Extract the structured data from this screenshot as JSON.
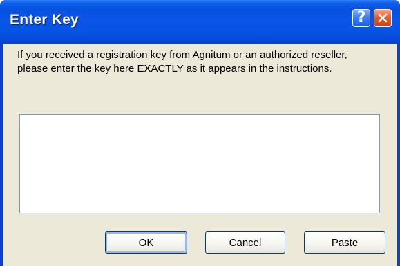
{
  "window": {
    "title": "Enter Key",
    "help_glyph": "?",
    "close_icon": "close-x-icon",
    "help_icon": "help-question-icon"
  },
  "dialog": {
    "message": "If you received a registration key from Agnitum or an authorized reseller, please enter the key here EXACTLY as it appears in the instructions.",
    "key_value": "",
    "buttons": {
      "ok": "OK",
      "cancel": "Cancel",
      "paste": "Paste"
    }
  },
  "colors": {
    "titlebar": "#0751e0",
    "client_background": "#ece9d8",
    "close_button": "#e4602f"
  }
}
